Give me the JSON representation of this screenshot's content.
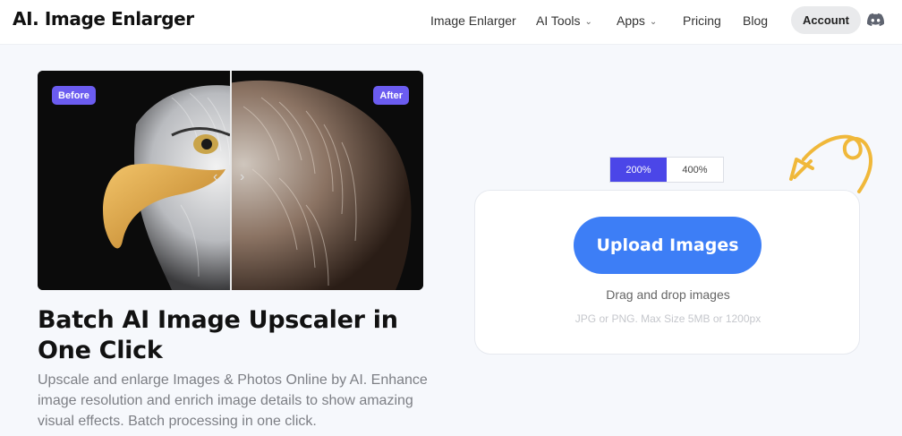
{
  "header": {
    "logo": "AI. Image Enlarger",
    "nav": [
      {
        "label": "Image Enlarger",
        "dropdown": false
      },
      {
        "label": "AI Tools",
        "dropdown": true
      },
      {
        "label": "Apps",
        "dropdown": true
      },
      {
        "label": "Pricing",
        "dropdown": false
      },
      {
        "label": "Blog",
        "dropdown": false
      }
    ],
    "account_label": "Account",
    "discord_icon": "discord-icon"
  },
  "compare": {
    "before_label": "Before",
    "after_label": "After"
  },
  "hero": {
    "title": "Batch AI Image Upscaler in One Click",
    "description": "Upscale and enlarge Images & Photos Online by AI. Enhance image resolution and enrich image details to show amazing visual effects. Batch processing in one click."
  },
  "upload": {
    "scale_options": [
      "200%",
      "400%"
    ],
    "selected_scale": "200%",
    "button_label": "Upload Images",
    "drag_text": "Drag and drop images",
    "hint_text": "JPG or PNG. Max Size 5MB or 1200px"
  },
  "colors": {
    "accent": "#4b46e8",
    "upload_button": "#3d7ef6",
    "badge": "#6b5cf0",
    "arrow_doodle": "#f0b83a"
  }
}
